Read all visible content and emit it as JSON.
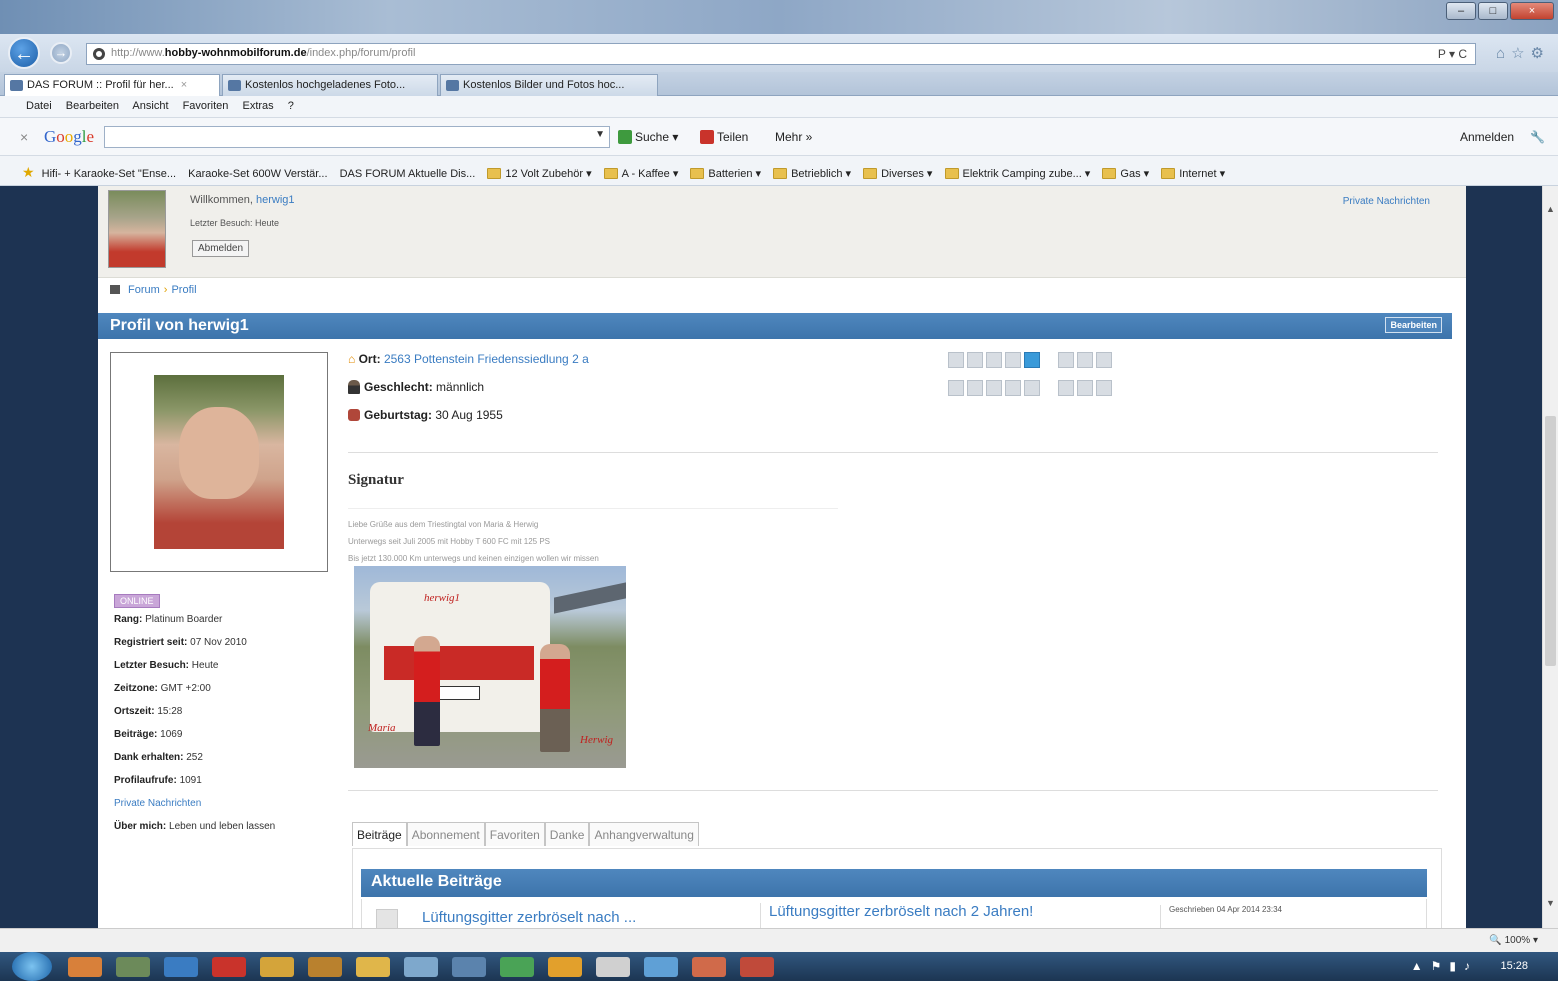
{
  "browser": {
    "address_host": "http://www.",
    "address_bold": "hobby-wohnmobilforum.de",
    "address_path": "/index.php/forum/profil",
    "address_tools": "P ▾ C",
    "tabs": [
      {
        "label": "DAS FORUM :: Profil für her...",
        "close": "×"
      },
      {
        "label": "Kostenlos hochgeladenes Foto..."
      },
      {
        "label": "Kostenlos Bilder und Fotos hoc..."
      }
    ],
    "menu": [
      "Datei",
      "Bearbeiten",
      "Ansicht",
      "Favoriten",
      "Extras",
      "?"
    ],
    "google": {
      "close": "×",
      "logo": "Google",
      "search_value": "",
      "search": "Suche ▾",
      "share": "Teilen",
      "more": "Mehr »",
      "signin": "Anmelden"
    },
    "favorites": [
      "Hifi- + Karaoke-Set \"Ense...",
      "Karaoke-Set 600W Verstär...",
      "DAS FORUM Aktuelle Dis...",
      "12 Volt Zubehör ▾",
      "A - Kaffee ▾",
      "Batterien ▾",
      "Betrieblich ▾",
      "Diverses ▾",
      "Elektrik Camping zube... ▾",
      "Gas ▾",
      "Internet ▾"
    ],
    "zoom": "100%"
  },
  "welcome": {
    "greeting": "Willkommen,",
    "user": "herwig1",
    "last_visit": "Letzter Besuch: Heute",
    "logout": "Abmelden",
    "private_messages": "Private Nachrichten"
  },
  "breadcrumb": {
    "forum": "Forum",
    "sep": "›",
    "profile": "Profil"
  },
  "profile": {
    "title": "Profil von herwig1",
    "edit": "Bearbeiten",
    "location_label": "Ort:",
    "location": "2563 Pottenstein Friedenssiedlung 2 a",
    "gender_label": "Geschlecht:",
    "gender": "männlich",
    "birthday_label": "Geburtstag:",
    "birthday": "30 Aug 1955",
    "online": "ONLINE",
    "stats": [
      {
        "label": "Rang:",
        "value": "Platinum Boarder"
      },
      {
        "label": "Registriert seit:",
        "value": "07 Nov 2010"
      },
      {
        "label": "Letzter Besuch:",
        "value": "Heute"
      },
      {
        "label": "Zeitzone:",
        "value": "GMT +2:00"
      },
      {
        "label": "Ortszeit:",
        "value": "15:28"
      },
      {
        "label": "Beiträge:",
        "value": "1069"
      },
      {
        "label": "Dank erhalten:",
        "value": "252"
      },
      {
        "label": "Profilaufrufe:",
        "value": "1091"
      }
    ],
    "pm_link": "Private Nachrichten",
    "about_label": "Über mich:",
    "about": "Leben und leben lassen"
  },
  "signature": {
    "title": "Signatur",
    "lines": [
      "Liebe Grüße aus dem Triestingtal von Maria & Herwig",
      "Unterwegs seit Juli 2005 mit Hobby T 600 FC mit 125 PS",
      "Bis jetzt 130.000 Km unterwegs und keinen einzigen wollen wir missen"
    ],
    "photo_labels": [
      "herwig1",
      "Maria",
      "Herwig"
    ]
  },
  "tabs": [
    "Beiträge",
    "Abonnement",
    "Favoriten",
    "Danke",
    "Anhangverwaltung"
  ],
  "posts": {
    "header": "Aktuelle Beiträge",
    "rows": [
      {
        "title_short": "Lüftungsgitter zerbröselt nach ...",
        "title_full": "Lüftungsgitter zerbröselt nach 2 Jahren!",
        "meta": "Geschrieben 04 Apr 2014 23:34"
      }
    ]
  },
  "taskbar": {
    "clock": "15:28"
  },
  "colors": {
    "accent": "#3d74ab",
    "link": "#3a7cc2",
    "page_bg": "#1d3352"
  }
}
